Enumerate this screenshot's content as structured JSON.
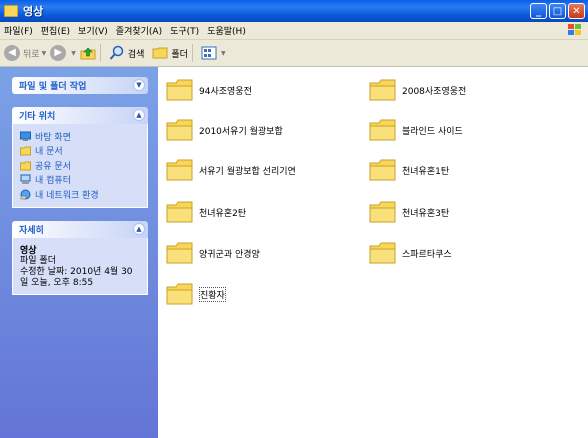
{
  "window": {
    "title": "영상"
  },
  "menu": [
    "파일(F)",
    "편집(E)",
    "보기(V)",
    "즐겨찾기(A)",
    "도구(T)",
    "도움말(H)"
  ],
  "toolbar": {
    "back": "뒤로",
    "search": "검색",
    "folders": "폴더"
  },
  "tasks": {
    "file_tasks": {
      "title": "파일 및 폴더 작업"
    },
    "other_places": {
      "title": "기타 위치",
      "items": [
        "바탕 화면",
        "내 문서",
        "공유 문서",
        "내 컴퓨터",
        "내 네트워크 환경"
      ]
    },
    "details": {
      "title": "자세히",
      "name": "영상",
      "type": "파일 폴더",
      "modified_line1": "수정한 날짜: 2010년 4월 30",
      "modified_line2": "일 오늘, 오후 8:55"
    }
  },
  "folders": [
    "94사조영웅전",
    "2008사조영웅전",
    "2010서유기 월광보합",
    "블라인드 사이드",
    "서유기 월광보합 선리기연",
    "천녀유혼1탄",
    "천녀유혼2탄",
    "천녀유혼3탄",
    "양귀군과 안경양",
    "스파르타쿠스",
    "진황자"
  ],
  "colors": {
    "titlebar": "#0a5ee8",
    "taskpane": "#6f8ee0",
    "folder": "#f7d659"
  }
}
